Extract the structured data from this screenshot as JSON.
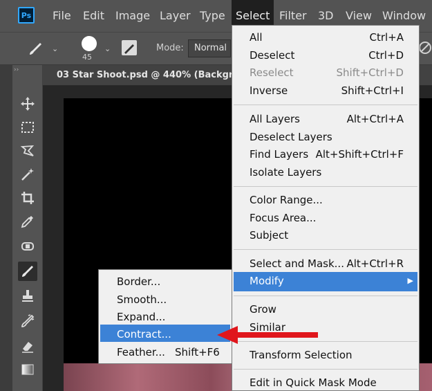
{
  "app": {
    "logo_text": "Ps",
    "accent_color": "#31a8ff"
  },
  "menubar": {
    "items": [
      "File",
      "Edit",
      "Image",
      "Layer",
      "Type",
      "Select",
      "Filter",
      "3D",
      "View",
      "Window"
    ],
    "active": "Select"
  },
  "options_bar": {
    "brush_size": "45",
    "mode_label": "Mode:",
    "mode_value": "Normal"
  },
  "document": {
    "tab_title": "03 Star Shoot.psd @ 440% (Backgro"
  },
  "select_menu": {
    "items": [
      {
        "label": "All",
        "shortcut": "Ctrl+A",
        "disabled": false
      },
      {
        "label": "Deselect",
        "shortcut": "Ctrl+D",
        "disabled": false
      },
      {
        "label": "Reselect",
        "shortcut": "Shift+Ctrl+D",
        "disabled": true
      },
      {
        "label": "Inverse",
        "shortcut": "Shift+Ctrl+I",
        "disabled": false
      },
      {
        "label": "All Layers",
        "shortcut": "Alt+Ctrl+A",
        "disabled": false
      },
      {
        "label": "Deselect Layers",
        "shortcut": "",
        "disabled": false
      },
      {
        "label": "Find Layers",
        "shortcut": "Alt+Shift+Ctrl+F",
        "disabled": false
      },
      {
        "label": "Isolate Layers",
        "shortcut": "",
        "disabled": false
      },
      {
        "label": "Color Range...",
        "shortcut": "",
        "disabled": false
      },
      {
        "label": "Focus Area...",
        "shortcut": "",
        "disabled": false
      },
      {
        "label": "Subject",
        "shortcut": "",
        "disabled": false
      },
      {
        "label": "Select and Mask...",
        "shortcut": "Alt+Ctrl+R",
        "disabled": false
      },
      {
        "label": "Modify",
        "shortcut": "",
        "disabled": false,
        "highlighted": true
      },
      {
        "label": "Grow",
        "shortcut": "",
        "disabled": false
      },
      {
        "label": "Similar",
        "shortcut": "",
        "disabled": false
      },
      {
        "label": "Transform Selection",
        "shortcut": "",
        "disabled": false
      },
      {
        "label": "Edit in Quick Mask Mode",
        "shortcut": "",
        "disabled": false
      }
    ],
    "highlight_color": "#3c82d6"
  },
  "modify_submenu": {
    "items": [
      {
        "label": "Border...",
        "shortcut": ""
      },
      {
        "label": "Smooth...",
        "shortcut": ""
      },
      {
        "label": "Expand...",
        "shortcut": ""
      },
      {
        "label": "Contract...",
        "shortcut": "",
        "highlighted": true
      },
      {
        "label": "Feather...",
        "shortcut": "Shift+F6"
      }
    ]
  },
  "annotation": {
    "arrow_color": "#e0161c",
    "points_to": "Contract..."
  },
  "toolbar": {
    "tools": [
      "move-icon",
      "marquee-icon",
      "lasso-icon",
      "magic-wand-icon",
      "crop-icon",
      "eyedropper-icon",
      "healing-brush-icon",
      "brush-icon",
      "clone-stamp-icon",
      "history-brush-icon",
      "eraser-icon",
      "gradient-icon"
    ],
    "selected": "brush-icon"
  }
}
